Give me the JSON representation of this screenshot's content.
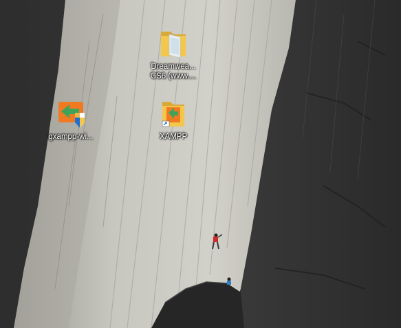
{
  "desktop": {
    "wallpaper": "granite-cliff-with-climbers",
    "icons": [
      {
        "label": "gxampp-wi...",
        "icon": "xampp-installer-shield-icon"
      },
      {
        "label": "Dreamwea...\nCS6 (www....",
        "icon": "folder-icon"
      },
      {
        "label": "XAMPP",
        "icon": "xampp-folder-shortcut-icon"
      }
    ]
  },
  "colors": {
    "rock_light": "#c9c8c0",
    "rock_dark": "#2b2b2b",
    "folder_yellow": "#f3c74b",
    "xampp_orange": "#f07a22",
    "shield_blue": "#1f6fd0"
  }
}
